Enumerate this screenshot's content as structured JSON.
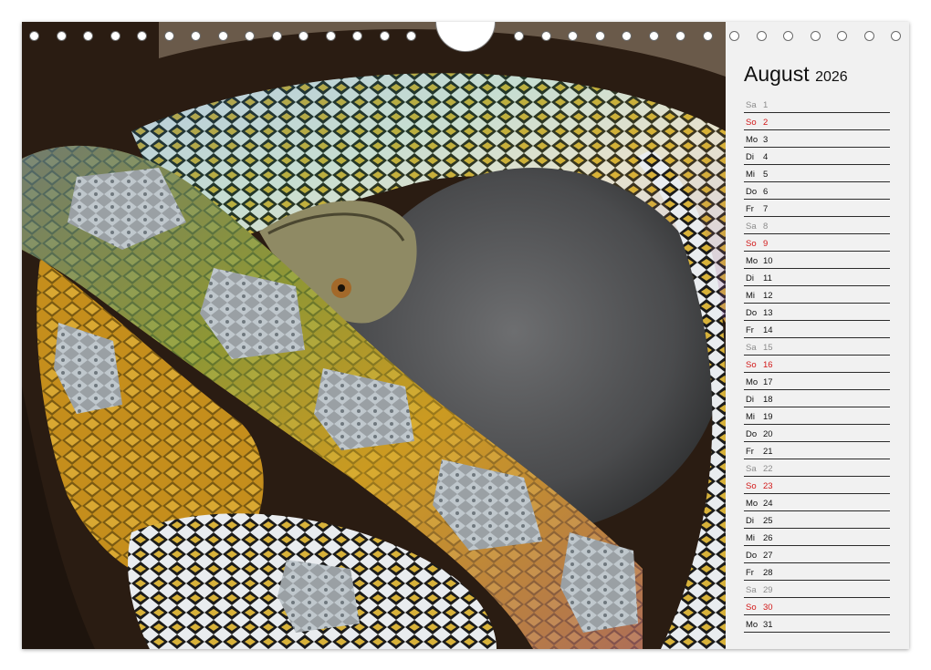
{
  "calendar": {
    "month": "August",
    "year": "2026",
    "days": [
      {
        "name": "Sa",
        "num": "1",
        "type": "sat"
      },
      {
        "name": "So",
        "num": "2",
        "type": "sun"
      },
      {
        "name": "Mo",
        "num": "3",
        "type": "wk"
      },
      {
        "name": "Di",
        "num": "4",
        "type": "wk"
      },
      {
        "name": "Mi",
        "num": "5",
        "type": "wk"
      },
      {
        "name": "Do",
        "num": "6",
        "type": "wk"
      },
      {
        "name": "Fr",
        "num": "7",
        "type": "wk"
      },
      {
        "name": "Sa",
        "num": "8",
        "type": "sat"
      },
      {
        "name": "So",
        "num": "9",
        "type": "sun"
      },
      {
        "name": "Mo",
        "num": "10",
        "type": "wk"
      },
      {
        "name": "Di",
        "num": "11",
        "type": "wk"
      },
      {
        "name": "Mi",
        "num": "12",
        "type": "wk"
      },
      {
        "name": "Do",
        "num": "13",
        "type": "wk"
      },
      {
        "name": "Fr",
        "num": "14",
        "type": "wk"
      },
      {
        "name": "Sa",
        "num": "15",
        "type": "sat"
      },
      {
        "name": "So",
        "num": "16",
        "type": "sun"
      },
      {
        "name": "Mo",
        "num": "17",
        "type": "wk"
      },
      {
        "name": "Di",
        "num": "18",
        "type": "wk"
      },
      {
        "name": "Mi",
        "num": "19",
        "type": "wk"
      },
      {
        "name": "Do",
        "num": "20",
        "type": "wk"
      },
      {
        "name": "Fr",
        "num": "21",
        "type": "wk"
      },
      {
        "name": "Sa",
        "num": "22",
        "type": "sat"
      },
      {
        "name": "So",
        "num": "23",
        "type": "sun"
      },
      {
        "name": "Mo",
        "num": "24",
        "type": "wk"
      },
      {
        "name": "Di",
        "num": "25",
        "type": "wk"
      },
      {
        "name": "Mi",
        "num": "26",
        "type": "wk"
      },
      {
        "name": "Do",
        "num": "27",
        "type": "wk"
      },
      {
        "name": "Fr",
        "num": "28",
        "type": "wk"
      },
      {
        "name": "Sa",
        "num": "29",
        "type": "sat"
      },
      {
        "name": "So",
        "num": "30",
        "type": "sun"
      },
      {
        "name": "Mo",
        "num": "31",
        "type": "wk"
      }
    ]
  },
  "colors": {
    "sunday": "#d21919",
    "saturday": "#8c8c8c",
    "weekday": "#111111"
  },
  "photo": {
    "subject": "reticulated python coiled around a grey rodent"
  },
  "binding": {
    "icon": "spiral-binding-holes"
  }
}
